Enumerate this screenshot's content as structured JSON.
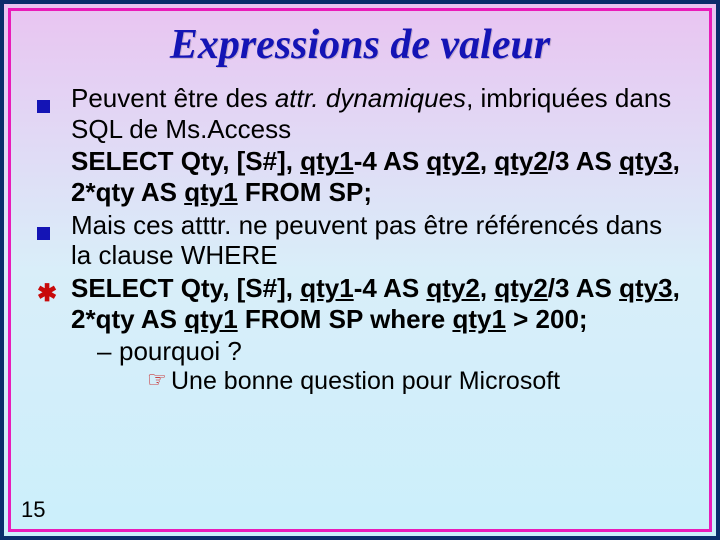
{
  "title": "Expressions de valeur",
  "bullets": {
    "b1": {
      "pre": "Peuvent être des ",
      "dyn": "attr. dynamiques",
      "post": ", imbriquées dans SQL de Ms.Access"
    },
    "sql1": {
      "part1": "SELECT  Qty,  [S#], ",
      "u1": "qty1",
      "part2": "-4 AS ",
      "u2": "qty2",
      "part3": ", ",
      "u3": "qty2",
      "part4": "/3 AS ",
      "u4": "qty3",
      "part5": ", 2*qty AS ",
      "u5": "qty1",
      "part6": " FROM SP;"
    },
    "b2": "Mais ces atttr. ne peuvent pas être référencés dans la clause WHERE",
    "sql2": {
      "part1": "SELECT  Qty,  [S#], ",
      "u1": "qty1",
      "part2": "-4 AS ",
      "u2": "qty2",
      "part3": ", ",
      "u3": "qty2",
      "part4": "/3 AS ",
      "u4": "qty3",
      "part5": ", 2*qty AS ",
      "u5": "qty1",
      "part6": " FROM SP where ",
      "u6": "qty1",
      "part7": " > 200;"
    },
    "sub1": "pourquoi ?",
    "sub2": "Une bonne question pour Microsoft"
  },
  "page": "15"
}
